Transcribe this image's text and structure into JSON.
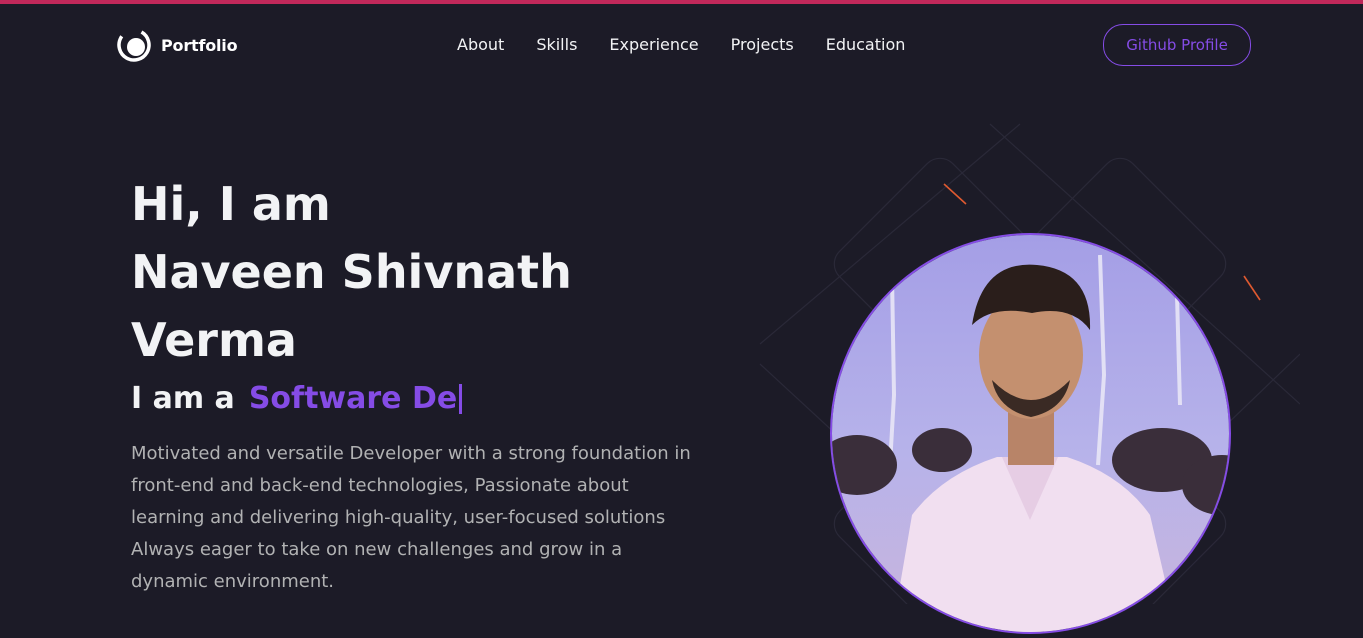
{
  "navbar": {
    "logo_text": "Portfolio",
    "links": [
      "About",
      "Skills",
      "Experience",
      "Projects",
      "Education"
    ],
    "github_button": "Github Profile"
  },
  "hero": {
    "greeting_line1": "Hi, I am",
    "name_line1": "Naveen Shivnath",
    "name_line2": "Verma",
    "role_prefix": "I am a",
    "role_typed": "Software De",
    "bio": "Motivated and versatile Developer with a strong foundation in front-end and back-end technologies, Passionate about learning and delivering high-quality, user-focused solutions Always eager to take on new challenges and grow in a dynamic environment."
  },
  "colors": {
    "background": "#1c1b27",
    "accent": "#854ce6",
    "top_strip": "#c0285a",
    "text_primary": "#f2f3f5",
    "text_secondary": "#b1b2b3"
  },
  "icons": {
    "logo": "portfolio-logo-icon",
    "cursor": "typing-cursor-icon"
  }
}
